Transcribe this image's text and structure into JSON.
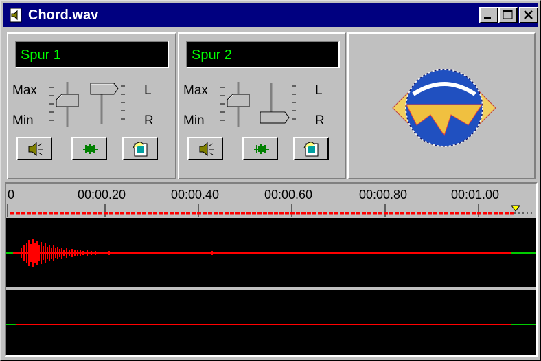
{
  "window": {
    "title": "Chord.wav"
  },
  "tracks": [
    {
      "name": "Spur 1",
      "max": "Max",
      "min": "Min",
      "left": "L",
      "right": "R"
    },
    {
      "name": "Spur 2",
      "max": "Max",
      "min": "Min",
      "left": "L",
      "right": "R"
    }
  ],
  "timeline": {
    "labels": [
      "0",
      "00:00.20",
      "00:00.40",
      "00:00.60",
      "00:00.80",
      "00:01.00"
    ]
  },
  "colors": {
    "titlebar": "#000080",
    "track_name": "#00ff00",
    "waveform": "#ff0000",
    "marker": "#ffff00",
    "line_end": "#00cc00"
  },
  "icons": [
    "speaker-icon",
    "waveform-icon",
    "hand-paper-icon",
    "globe-icon",
    "document-icon"
  ]
}
